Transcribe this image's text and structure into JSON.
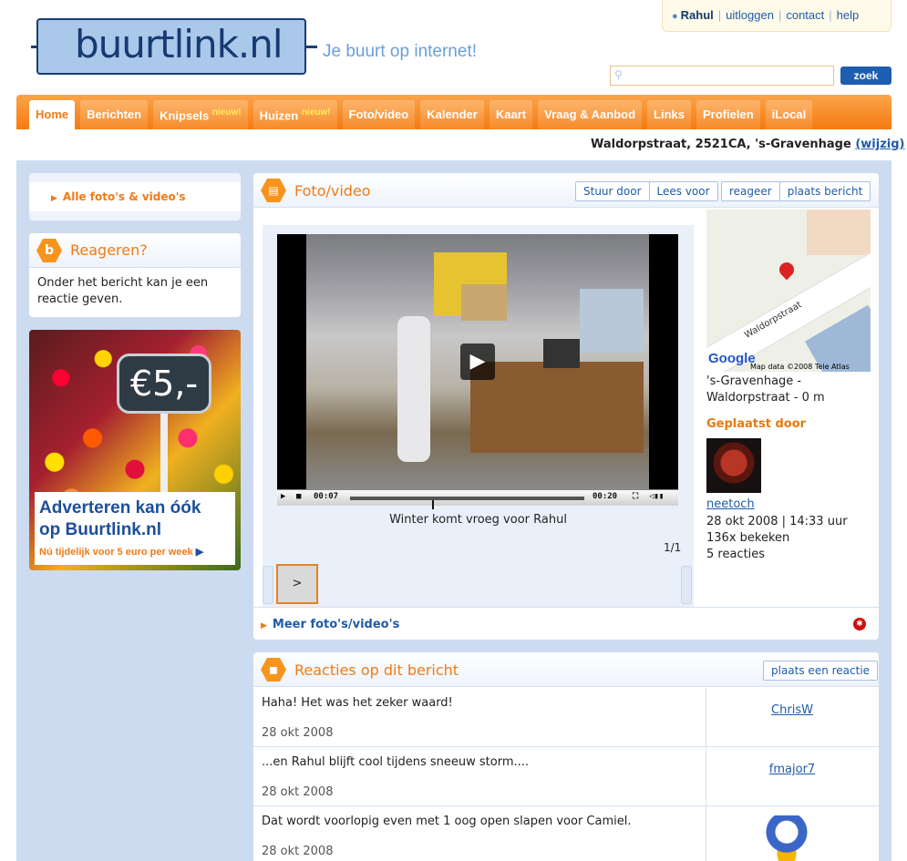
{
  "header": {
    "logo_text": "buurtlink.nl",
    "tagline": "Je buurt op internet!",
    "user": {
      "name": "Rahul",
      "logout": "uitloggen",
      "contact": "contact",
      "help": "help"
    },
    "search": {
      "placeholder": "",
      "button": "zoek"
    }
  },
  "nav": {
    "items": [
      {
        "label": "Home",
        "active": true,
        "badge": ""
      },
      {
        "label": "Berichten",
        "badge": ""
      },
      {
        "label": "Knipsels",
        "badge": "nieuw!"
      },
      {
        "label": "Huizen",
        "badge": "nieuw!"
      },
      {
        "label": "Foto/video",
        "badge": ""
      },
      {
        "label": "Kalender",
        "badge": ""
      },
      {
        "label": "Kaart",
        "badge": ""
      },
      {
        "label": "Vraag & Aanbod",
        "badge": ""
      },
      {
        "label": "Links",
        "badge": ""
      },
      {
        "label": "Profielen",
        "badge": ""
      },
      {
        "label": "iLocal",
        "badge": ""
      }
    ],
    "address": "Waldorpstraat, 2521CA, 's-Gravenhage",
    "address_change": "(wijzig)"
  },
  "sidebar": {
    "all_link": "Alle foto's & video's",
    "reageren": {
      "icon": "b",
      "title": "Reageren?",
      "text": "Onder het bericht kan je een reactie geven."
    },
    "ad": {
      "price": "€5,-",
      "line1": "Adverteren kan óók",
      "line2": "op Buurtlink.nl",
      "line3": "Nú tijdelijk voor 5 euro per week"
    }
  },
  "foto": {
    "title": "Foto/video",
    "buttons": {
      "stuur": "Stuur door",
      "lees": "Lees voor",
      "reageer": "reageer",
      "plaats": "plaats bericht"
    },
    "video": {
      "time_current": "00:07",
      "time_total": "00:20",
      "progress": 0.35,
      "caption": "Winter komt vroeg voor Rahul",
      "counter": "1/1",
      "thumb_label": ">"
    },
    "map": {
      "street_label": "Waldorpstraat",
      "google": "Google",
      "copyright": "Map data ©2008 Tele Atlas",
      "location": "'s-Gravenhage - Waldorpstraat - 0 m"
    },
    "posted": {
      "heading": "Geplaatst door",
      "name": "neetoch",
      "date": "28 okt 2008 | 14:33 uur",
      "views": "136x bekeken",
      "reactions": "5 reacties"
    },
    "more": "Meer foto's/video's"
  },
  "reacties": {
    "title": "Reacties op dit bericht",
    "button": "plaats een reactie",
    "items": [
      {
        "msg": "Haha! Het was het zeker waard!",
        "date": "28 okt 2008",
        "user": "ChrisW"
      },
      {
        "msg": "...en Rahul blijft cool tijdens sneeuw storm....",
        "date": "28 okt 2008",
        "user": "fmajor7"
      },
      {
        "msg": "Dat wordt voorlopig even met 1 oog open slapen voor Camiel.",
        "date": "28 okt 2008",
        "user": ""
      }
    ]
  }
}
